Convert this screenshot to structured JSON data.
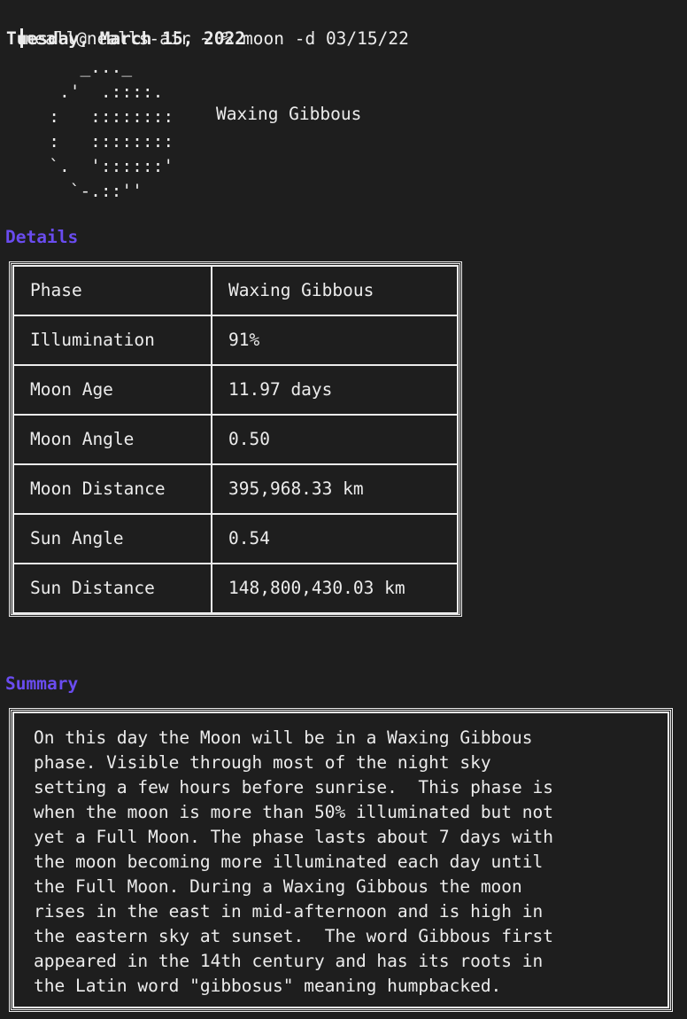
{
  "terminal": {
    "prompt": "neall@nealls-air ~ % moon -d 03/15/22",
    "date_line": "Tuesday, March 15, 2022"
  },
  "moon": {
    "ascii_art": "      _..._\n    .'  .::::.\n   :   ::::::::\n   :   ::::::::\n   `.  '::::::'\n     `-.::''",
    "phase_label": "Waxing Gibbous"
  },
  "details": {
    "heading": "Details",
    "rows": [
      {
        "label": "Phase",
        "value": "Waxing Gibbous"
      },
      {
        "label": "Illumination",
        "value": "91%"
      },
      {
        "label": "Moon Age",
        "value": "11.97 days"
      },
      {
        "label": "Moon Angle",
        "value": "0.50"
      },
      {
        "label": "Moon Distance",
        "value": "395,968.33 km"
      },
      {
        "label": "Sun Angle",
        "value": "0.54"
      },
      {
        "label": "Sun Distance",
        "value": "148,800,430.03 km"
      }
    ]
  },
  "summary": {
    "heading": "Summary",
    "lines": [
      "On this day the Moon will be in a Waxing Gibbous",
      "phase. Visible through most of the night sky",
      "setting a few hours before sunrise.  This phase is",
      "when the moon is more than 50% illuminated but not",
      "yet a Full Moon. The phase lasts about 7 days with",
      "the moon becoming more illuminated each day until",
      "the Full Moon. During a Waxing Gibbous the moon",
      "rises in the east in mid-afternoon and is high in",
      "the eastern sky at sunset.  The word Gibbous first",
      "appeared in the 14th century and has its roots in",
      "the Latin word \"gibbosus\" meaning humpbacked."
    ]
  }
}
